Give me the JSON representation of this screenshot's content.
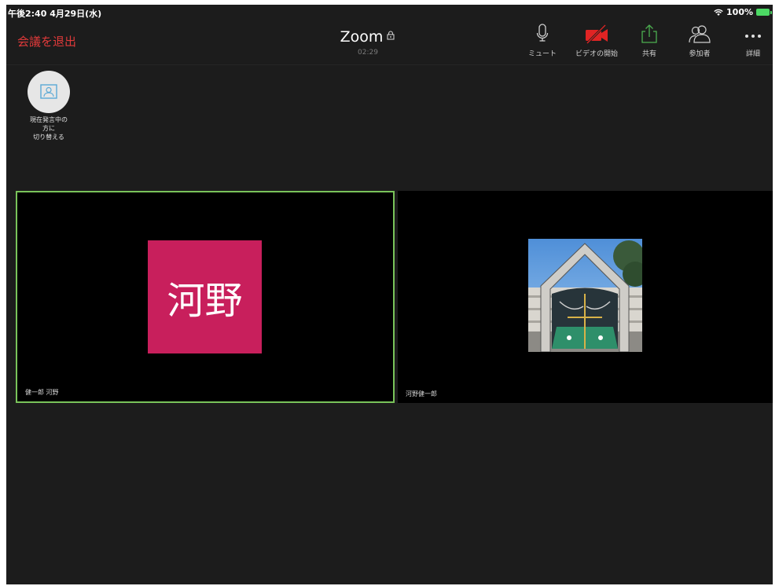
{
  "status_bar": {
    "time_date": "午後2:40  4月29日(水)",
    "battery": "100%"
  },
  "toolbar": {
    "leave_label": "会議を退出",
    "title": "Zoom",
    "duration": "02:29",
    "buttons": [
      {
        "icon": "microphone-icon",
        "label": "ミュート"
      },
      {
        "icon": "video-off-icon",
        "label": "ビデオの開始"
      },
      {
        "icon": "share-icon",
        "label": "共有"
      },
      {
        "icon": "participants-icon",
        "label": "参加者"
      },
      {
        "icon": "more-icon",
        "label": "詳細"
      }
    ]
  },
  "switch_view": {
    "label": "現在発言中の\n方に\n切り替える"
  },
  "tiles": [
    {
      "name": "健一郎 河野",
      "avatar_text": "河野",
      "active": true
    },
    {
      "name": "河野健一郎",
      "avatar": "school-gate-photo",
      "active": false
    }
  ],
  "colors": {
    "background": "#1c1c1c",
    "leave": "#e03a3a",
    "video_off": "#e02424",
    "share": "#4caf50",
    "active_border": "#79c35a",
    "avatar_bg": "#c81f5c"
  }
}
